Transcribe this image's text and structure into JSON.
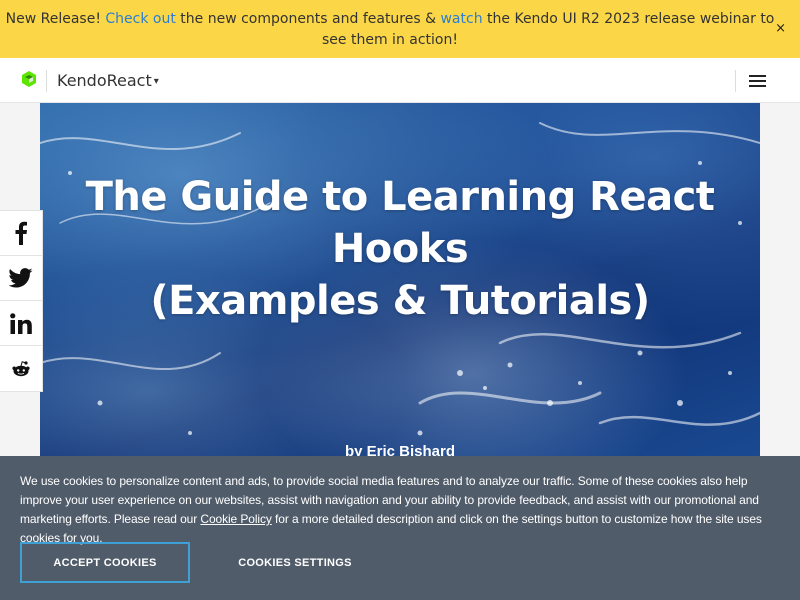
{
  "banner": {
    "prefix": "New Release! ",
    "link1": "Check out",
    "middle": " the new components and features & ",
    "link2": "watch",
    "suffix": " the Kendo UI R2 2023 release webinar to see them in action!",
    "close": "×"
  },
  "header": {
    "logo_icon": "progress-logo-icon",
    "product": "KendoReact",
    "product_caret": "▾",
    "menu_icon": "hamburger-menu-icon"
  },
  "hero": {
    "title_line1": "The Guide to Learning React",
    "title_line2": "Hooks",
    "title_line3": "(Examples & Tutorials)",
    "author": "by Eric Bishard"
  },
  "social": {
    "items": [
      {
        "name": "facebook",
        "icon": "facebook-icon"
      },
      {
        "name": "twitter",
        "icon": "twitter-icon"
      },
      {
        "name": "linkedin",
        "icon": "linkedin-icon"
      },
      {
        "name": "reddit",
        "icon": "reddit-icon"
      }
    ]
  },
  "cookie": {
    "text_before": "We use cookies to personalize content and ads, to provide social media features and to analyze our traffic. Some of these cookies also help improve your user experience on our websites, assist with navigation and your ability to provide feedback, and assist with our promotional and marketing efforts. Please read our ",
    "policy_link": "Cookie Policy",
    "text_after": " for a more detailed description and click on the settings button to customize how the site uses cookies for you.",
    "accept_label": "ACCEPT COOKIES",
    "settings_label": "COOKIES SETTINGS"
  },
  "colors": {
    "banner_bg": "#fbd646",
    "link": "#2a7fd4",
    "brand_green": "#5ce500",
    "cookie_bg": "#515c6a",
    "accept_border": "#3fa0d6"
  }
}
